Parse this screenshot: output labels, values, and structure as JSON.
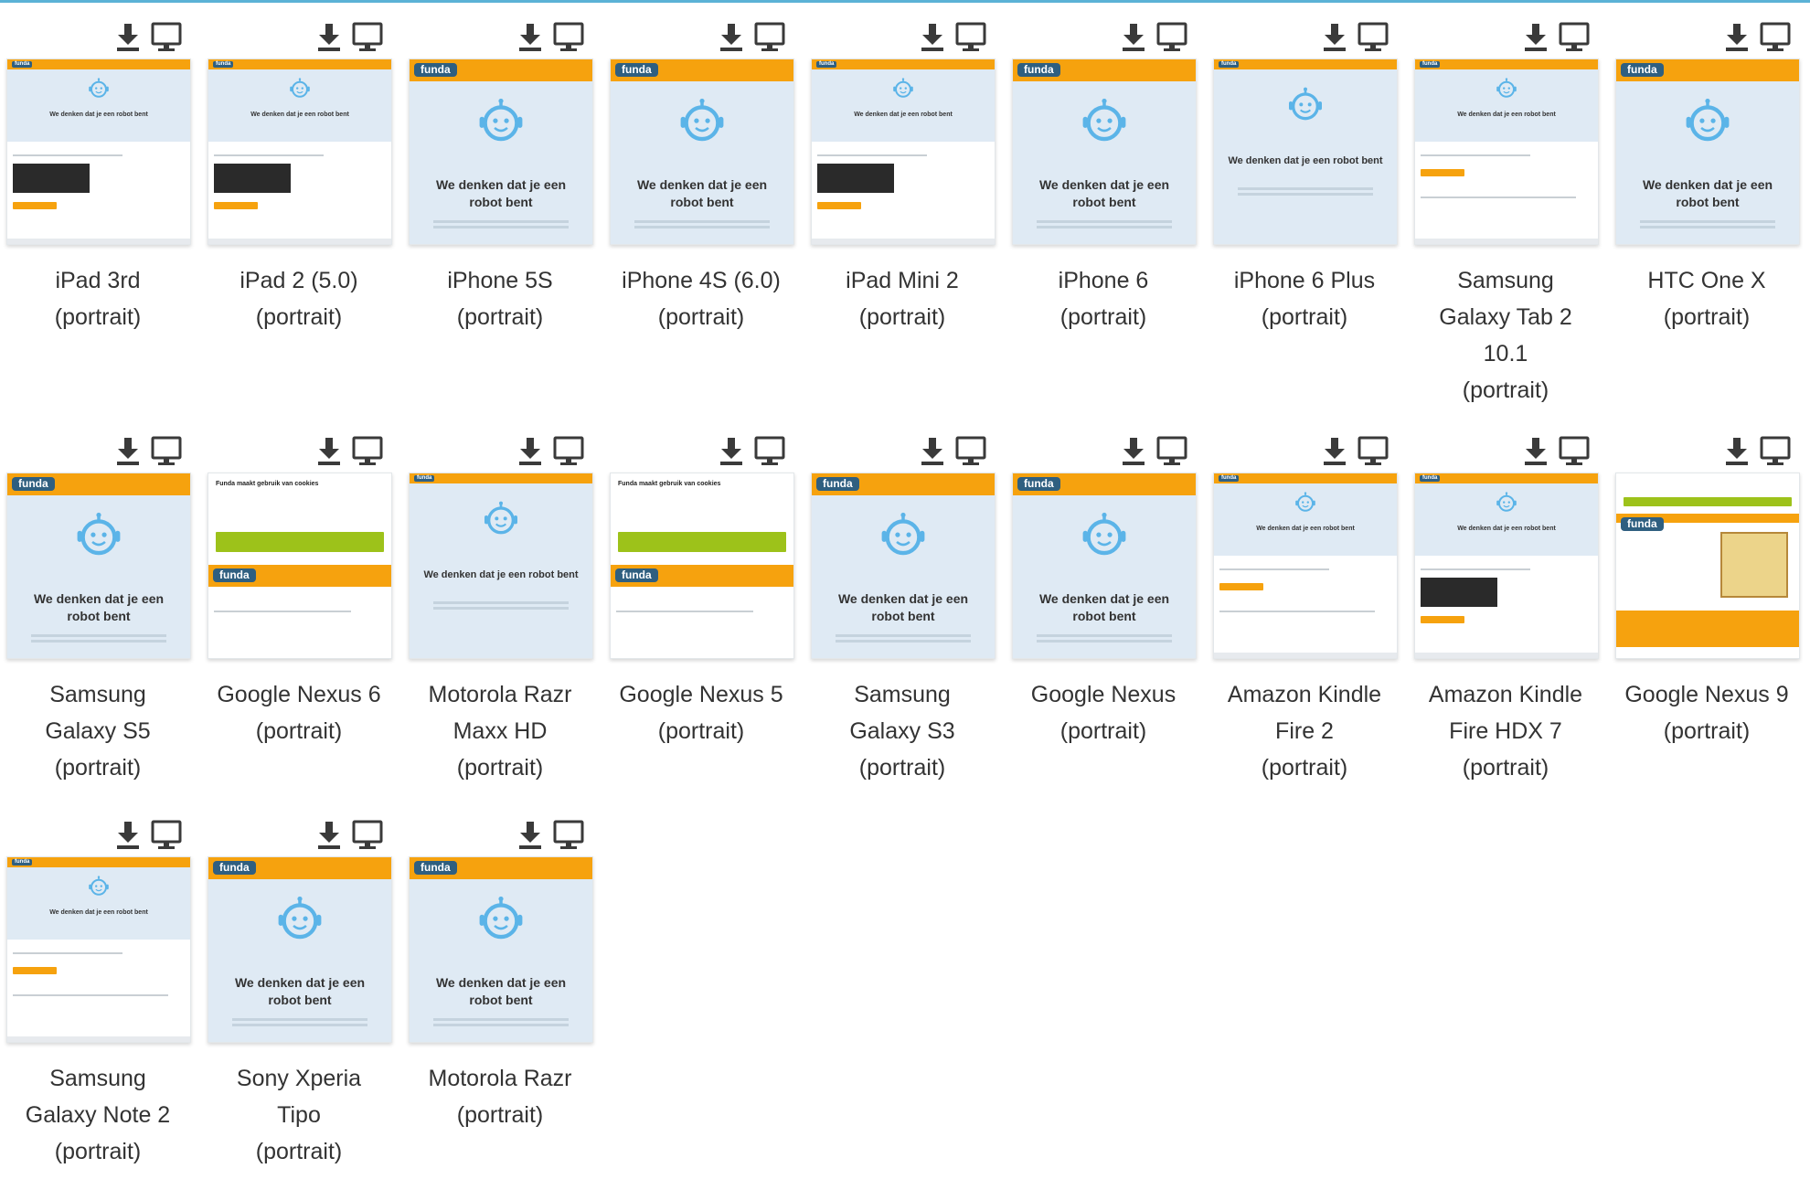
{
  "gallery": {
    "actions": {
      "download_icon": "download-icon",
      "view_icon": "monitor-icon"
    },
    "colors": {
      "accent_line": "#5bb2d6",
      "screenshot_header": "#f6a20e",
      "screenshot_bg": "#dfeaf4",
      "cookie_button": "#9dc21a",
      "text": "#333333"
    },
    "devices": [
      {
        "name_lines": [
          "iPad 3rd",
          "(portrait)"
        ],
        "variant": "tablet"
      },
      {
        "name_lines": [
          "iPad 2 (5.0)",
          "(portrait)"
        ],
        "variant": "tablet"
      },
      {
        "name_lines": [
          "iPhone 5S",
          "(portrait)"
        ],
        "variant": "phone"
      },
      {
        "name_lines": [
          "iPhone 4S (6.0)",
          "(portrait)"
        ],
        "variant": "phone"
      },
      {
        "name_lines": [
          "iPad Mini 2",
          "(portrait)"
        ],
        "variant": "tablet"
      },
      {
        "name_lines": [
          "iPhone 6",
          "(portrait)"
        ],
        "variant": "phone"
      },
      {
        "name_lines": [
          "iPhone 6 Plus",
          "(portrait)"
        ],
        "variant": "phone_small"
      },
      {
        "name_lines": [
          "Samsung",
          "Galaxy Tab 2",
          "10.1",
          "(portrait)"
        ],
        "variant": "tablet_nocaptcha"
      },
      {
        "name_lines": [
          "HTC One X",
          "(portrait)"
        ],
        "variant": "phone"
      },
      {
        "name_lines": [
          "Samsung",
          "Galaxy S5",
          "(portrait)"
        ],
        "variant": "phone"
      },
      {
        "name_lines": [
          "Google Nexus 6",
          "(portrait)"
        ],
        "variant": "cookie"
      },
      {
        "name_lines": [
          "Motorola Razr",
          "Maxx HD",
          "(portrait)"
        ],
        "variant": "phone_small"
      },
      {
        "name_lines": [
          "Google Nexus 5",
          "(portrait)"
        ],
        "variant": "cookie"
      },
      {
        "name_lines": [
          "Samsung",
          "Galaxy S3",
          "(portrait)"
        ],
        "variant": "phone"
      },
      {
        "name_lines": [
          "Google Nexus",
          "(portrait)"
        ],
        "variant": "phone"
      },
      {
        "name_lines": [
          "Amazon Kindle",
          "Fire 2",
          "(portrait)"
        ],
        "variant": "tablet_nocaptcha"
      },
      {
        "name_lines": [
          "Amazon Kindle",
          "Fire HDX 7",
          "(portrait)"
        ],
        "variant": "tablet"
      },
      {
        "name_lines": [
          "Google Nexus 9",
          "(portrait)"
        ],
        "variant": "house"
      },
      {
        "name_lines": [
          "Samsung",
          "Galaxy Note 2",
          "(portrait)"
        ],
        "variant": "tablet_nocaptcha"
      },
      {
        "name_lines": [
          "Sony Xperia",
          "Tipo",
          "(portrait)"
        ],
        "variant": "phone"
      },
      {
        "name_lines": [
          "Motorola Razr",
          "(portrait)"
        ],
        "variant": "phone"
      }
    ],
    "screenshot_texts": {
      "brand": "funda",
      "message": "We denken dat je een robot bent",
      "cookie_title": "Funda maakt gebruik van cookies"
    }
  }
}
